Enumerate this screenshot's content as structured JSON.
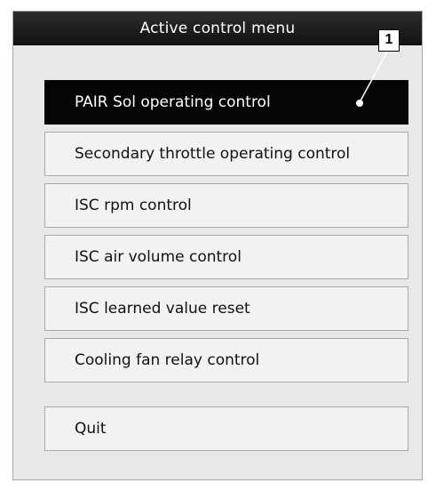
{
  "window": {
    "title": "Active control menu"
  },
  "menu": {
    "items": [
      {
        "label": "PAIR Sol operating control",
        "selected": true
      },
      {
        "label": "Secondary throttle operating control",
        "selected": false
      },
      {
        "label": "ISC rpm control",
        "selected": false
      },
      {
        "label": "ISC air volume control",
        "selected": false
      },
      {
        "label": "ISC learned value reset",
        "selected": false
      },
      {
        "label": "Cooling fan relay control",
        "selected": false
      }
    ],
    "quit_label": "Quit"
  },
  "callout": {
    "number": "1"
  },
  "colors": {
    "title_bar": "#1a1a1a",
    "panel": "#e8e8e8",
    "button": "#f2f2f2",
    "selected_button": "#050505"
  }
}
